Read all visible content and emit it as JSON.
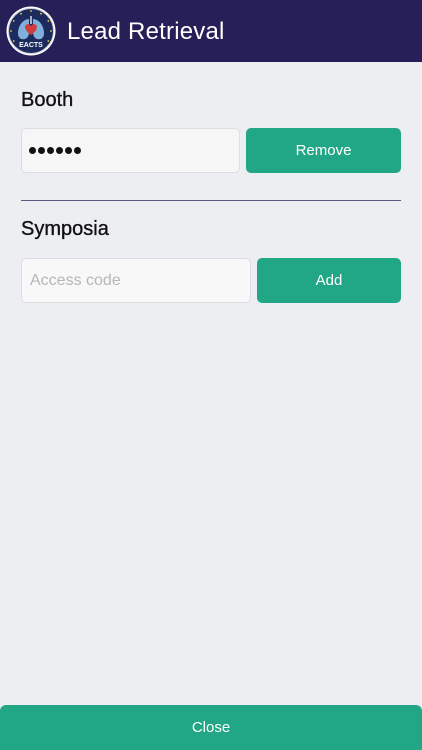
{
  "header": {
    "title": "Lead Retrieval",
    "logo_text": "EACTS"
  },
  "booth": {
    "title": "Booth",
    "password_length": 6,
    "button_label": "Remove"
  },
  "symposia": {
    "title": "Symposia",
    "placeholder": "Access code",
    "button_label": "Add"
  },
  "footer": {
    "close_label": "Close"
  },
  "colors": {
    "header_bg": "#271f57",
    "accent_green": "#22a786",
    "page_bg": "#edeef2"
  }
}
